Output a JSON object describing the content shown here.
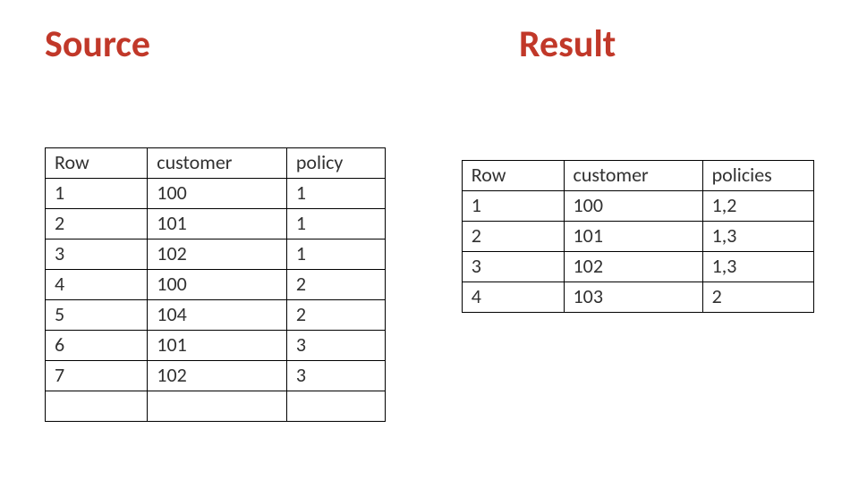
{
  "labels": {
    "source_heading": "Source",
    "result_heading": "Result"
  },
  "chart_data": [
    {
      "type": "table",
      "name": "source",
      "columns": [
        "Row",
        "customer",
        "policy"
      ],
      "rows": [
        [
          "1",
          "100",
          "1"
        ],
        [
          "2",
          "101",
          "1"
        ],
        [
          "3",
          "102",
          "1"
        ],
        [
          "4",
          "100",
          "2"
        ],
        [
          "5",
          "104",
          "2"
        ],
        [
          "6",
          "101",
          "3"
        ],
        [
          "7",
          "102",
          "3"
        ],
        [
          "",
          "",
          ""
        ]
      ]
    },
    {
      "type": "table",
      "name": "result",
      "columns": [
        "Row",
        "customer",
        "policies"
      ],
      "rows": [
        [
          "1",
          "100",
          "1,2"
        ],
        [
          "2",
          "101",
          "1,3"
        ],
        [
          "3",
          "102",
          "1,3"
        ],
        [
          "4",
          "103",
          "2"
        ]
      ]
    }
  ]
}
